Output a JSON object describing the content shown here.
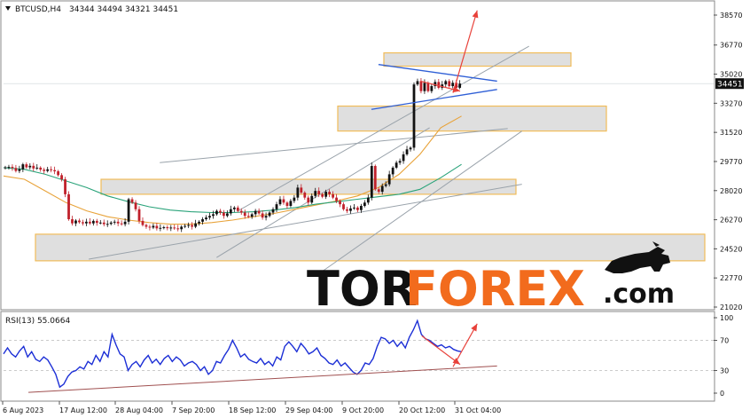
{
  "header": {
    "symbol": "BTCUSD,H4",
    "ohlc": "34344 34494 34321 34451"
  },
  "rsi_header": {
    "label": "RSI(13) 55.0664"
  },
  "watermark": {
    "tor": "TOR",
    "forex": "FOREX",
    "dotcom": ".com",
    "colors": {
      "tor": "#111111",
      "forex": "#f26b1d",
      "dotcom": "#111111"
    }
  },
  "colors": {
    "bull_candle": "#111111",
    "bear_candle": "#c0202a",
    "ma_fast": "#e8a33a",
    "ma_slow": "#2aa37a",
    "channel": "#9aa3ab",
    "triangle": "#2f5fd6",
    "forecast_arrow": "#e8413a",
    "zone_fill": "#dcdcdc",
    "zone_border": "#f0b548",
    "rsi_line": "#1c2fd6",
    "rsi_trend": "#a05050",
    "price_badge": "#111111"
  },
  "chart_data": [
    {
      "type": "line",
      "title": "BTCUSD,H4",
      "subtitle": "34344 34494 34321 34451",
      "x_tick_labels": [
        "6 Aug 2023",
        "17 Aug 12:00",
        "28 Aug 04:00",
        "7 Sep 20:00",
        "18 Sep 12:00",
        "29 Sep 04:00",
        "9 Oct 20:00",
        "20 Oct 12:00",
        "31 Oct 04:00"
      ],
      "y_tick_labels": [
        "38570",
        "36770",
        "35020",
        "33270",
        "31520",
        "29770",
        "28020",
        "26270",
        "24520",
        "22770",
        "21020"
      ],
      "ylim": [
        21020,
        38570
      ],
      "last_price": "34451",
      "series": [],
      "close_values": [
        29420,
        29450,
        29380,
        29200,
        29300,
        29600,
        29420,
        29510,
        29350,
        29400,
        29280,
        29200,
        29300,
        29250,
        29180,
        28950,
        28700,
        27800,
        26300,
        26050,
        26220,
        26120,
        26050,
        26150,
        26050,
        26200,
        26080,
        26100,
        26000,
        26020,
        26100,
        26150,
        26050,
        26000,
        26150,
        27500,
        27300,
        26900,
        26200,
        25950,
        25850,
        25800,
        25900,
        25750,
        25780,
        25820,
        25760,
        25800,
        25750,
        25700,
        25850,
        25900,
        25950,
        25850,
        26050,
        26150,
        26300,
        26400,
        26500,
        26600,
        26800,
        26700,
        26500,
        26650,
        26900,
        27000,
        26800,
        26700,
        26500,
        26450,
        26600,
        26800,
        26650,
        26400,
        26500,
        26700,
        26900,
        27200,
        27500,
        27300,
        27100,
        27400,
        27600,
        28200,
        27900,
        27600,
        27300,
        27700,
        28000,
        27800,
        27650,
        27950,
        27800,
        27600,
        27400,
        27200,
        26900,
        26800,
        26950,
        27000,
        26850,
        27100,
        27300,
        27600,
        29500,
        28100,
        27950,
        28300,
        28400,
        29000,
        29400,
        29700,
        29800,
        30200,
        30500,
        30600,
        34400,
        34600,
        34000,
        34500,
        34000,
        34300,
        34550,
        34200,
        34400,
        34600,
        34300,
        34500,
        34200,
        34451
      ],
      "moving_averages": [
        {
          "values": [
            28900,
            28700,
            28000,
            27300,
            26800,
            26450,
            26250,
            26100,
            26000,
            26000,
            26100,
            26250,
            26450,
            26650,
            26900,
            27150,
            27400,
            27700,
            28200,
            29000,
            30200,
            31800,
            32500
          ]
        },
        {
          "values": [
            29400,
            29300,
            29000,
            28600,
            28200,
            27700,
            27350,
            27050,
            26850,
            26750,
            26700,
            26700,
            26750,
            26850,
            27000,
            27200,
            27350,
            27500,
            27650,
            27800,
            28100,
            28800,
            29600
          ]
        }
      ],
      "zones": [
        {
          "from": 35500,
          "to": 36300
        },
        {
          "from": 31600,
          "to": 33100
        },
        {
          "from": 27800,
          "to": 28700
        },
        {
          "from": 23800,
          "to": 25400
        }
      ],
      "annotations": [
        {
          "kind": "channel",
          "from": [
            0.3,
            24000
          ],
          "to": [
            0.6,
            31800
          ]
        },
        {
          "kind": "channel",
          "from": [
            0.33,
            26800
          ],
          "to": [
            0.74,
            36700
          ]
        },
        {
          "kind": "channel",
          "from": [
            0.45,
            23200
          ],
          "to": [
            0.73,
            31600
          ]
        },
        {
          "kind": "channel",
          "from": [
            0.12,
            23900
          ],
          "to": [
            0.73,
            28400
          ]
        },
        {
          "kind": "channel",
          "from": [
            0.22,
            29700
          ],
          "to": [
            0.71,
            31750
          ]
        },
        {
          "kind": "triangle_upper",
          "from": [
            0.528,
            35600
          ],
          "to": [
            0.695,
            34600
          ]
        },
        {
          "kind": "triangle_lower",
          "from": [
            0.518,
            32900
          ],
          "to": [
            0.695,
            34100
          ]
        },
        {
          "kind": "forecast_arrow",
          "from": [
            0.633,
            33900
          ],
          "to": [
            0.667,
            38850
          ]
        },
        {
          "kind": "forecast_arrow",
          "from": [
            0.587,
            34600
          ],
          "to": [
            0.643,
            34000
          ]
        }
      ]
    },
    {
      "type": "line",
      "title": "RSI(13) 55.0664",
      "x_tick_labels": [
        "6 Aug 2023",
        "17 Aug 12:00",
        "28 Aug 04:00",
        "7 Sep 20:00",
        "18 Sep 12:00",
        "29 Sep 04:00",
        "9 Oct 20:00",
        "20 Oct 12:00",
        "31 Oct 04:00"
      ],
      "y_tick_labels": [
        "100",
        "70",
        "30",
        "0"
      ],
      "ylim": [
        0,
        100
      ],
      "series": [],
      "values": [
        52,
        60,
        52,
        48,
        56,
        62,
        48,
        55,
        45,
        42,
        48,
        44,
        35,
        25,
        8,
        12,
        22,
        28,
        30,
        35,
        32,
        42,
        38,
        50,
        42,
        55,
        48,
        78,
        64,
        52,
        48,
        30,
        38,
        42,
        35,
        44,
        50,
        40,
        45,
        38,
        46,
        50,
        42,
        48,
        44,
        36,
        40,
        42,
        38,
        30,
        35,
        25,
        30,
        42,
        40,
        50,
        58,
        70,
        60,
        48,
        52,
        45,
        42,
        40,
        46,
        38,
        42,
        36,
        48,
        44,
        62,
        68,
        62,
        55,
        66,
        60,
        52,
        55,
        60,
        50,
        46,
        40,
        38,
        44,
        36,
        40,
        34,
        28,
        25,
        30,
        40,
        38,
        46,
        62,
        74,
        72,
        66,
        70,
        62,
        68,
        60,
        74,
        84,
        96,
        78,
        72,
        70,
        66,
        62,
        64,
        60,
        62,
        58,
        56,
        55
      ],
      "annotations": [
        {
          "kind": "trendline",
          "from": [
            0.035,
            1
          ],
          "to": [
            0.695,
            36
          ]
        },
        {
          "kind": "forecast_arrow",
          "from": [
            0.633,
            35
          ],
          "to": [
            0.667,
            92
          ]
        },
        {
          "kind": "forecast_arrow",
          "from": [
            0.589,
            76
          ],
          "to": [
            0.643,
            38
          ]
        }
      ]
    }
  ]
}
